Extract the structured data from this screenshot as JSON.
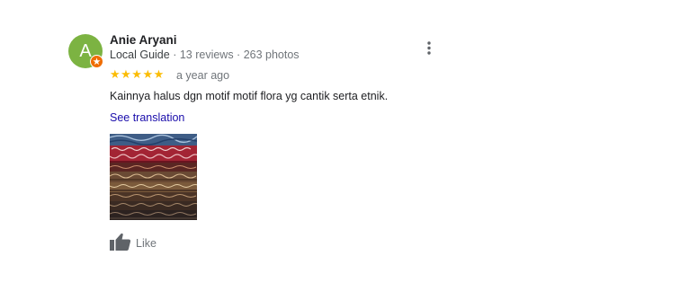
{
  "review": {
    "author": {
      "initial": "A",
      "name": "Anie Aryani",
      "guide_label": "Local Guide",
      "separator": " · ",
      "reviews": "13 reviews",
      "photos": "263 photos",
      "avatar_color": "#7cb342",
      "badge_color": "#ef6c00"
    },
    "rating": {
      "stars": 5,
      "max": 5,
      "display": "★★★★★",
      "color": "#fbbc04"
    },
    "age": "a year ago",
    "text": "Kainnya halus dgn motif motif flora yg cantik serta etnik.",
    "translate_label": "See translation",
    "photo": {
      "subject": "stack of folded batik fabrics"
    },
    "actions": {
      "like_label": "Like",
      "like_icon": "thumbs-up-icon",
      "menu_icon": "more-vert-icon"
    }
  }
}
